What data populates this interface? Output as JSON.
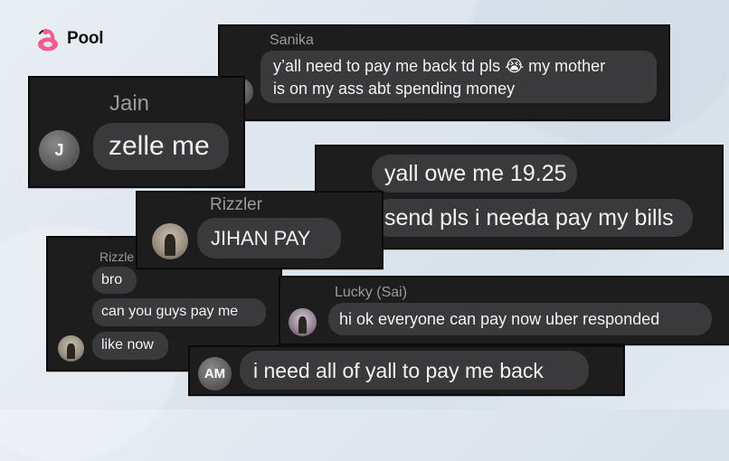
{
  "brand": {
    "name": "Pool"
  },
  "colors": {
    "card_bg": "#1d1d1d",
    "bubble_bg": "#3a3a3c",
    "sender_text": "#9b9b9b",
    "logo_pink": "#f25c8e"
  },
  "cards": {
    "sanika": {
      "sender": "Sanika",
      "avatar_initials": "S",
      "line1": "y’all need to pay me back td pls 😭 my mother",
      "line2": "is on my ass abt spending money"
    },
    "jain": {
      "sender": "Jain",
      "avatar_initials": "J",
      "message": "zelle me"
    },
    "owe": {
      "message1": "yall owe me 19.25",
      "message2": "send pls i needa pay my bills"
    },
    "rizzler": {
      "sender": "Rizzler",
      "message": "JIHAN PAY"
    },
    "rizzler_small": {
      "sender": "Rizzle",
      "message1": "bro",
      "message2": "can you guys pay me",
      "message3": "like now"
    },
    "lucky": {
      "sender": "Lucky (Sai)",
      "message": "hi ok everyone can pay now uber responded"
    },
    "am": {
      "avatar_initials": "AM",
      "message": "i need all of yall to pay me back"
    }
  }
}
